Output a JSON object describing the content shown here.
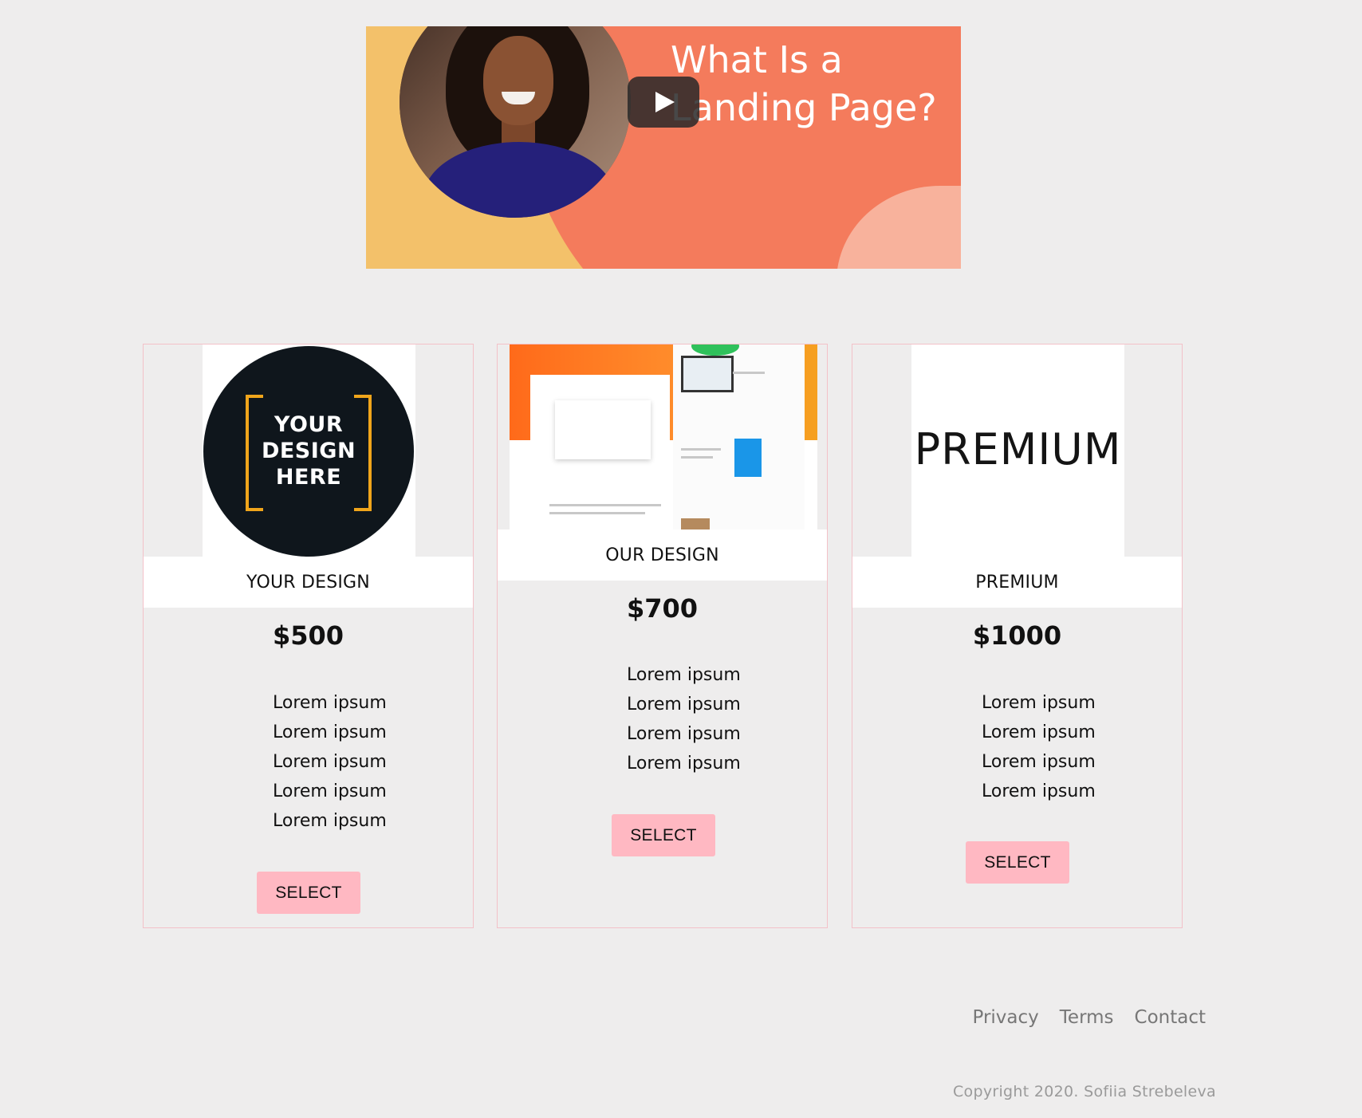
{
  "video": {
    "title_line1": "What Is a",
    "title_line2": "Landing Page?",
    "play_icon": "play-icon",
    "colors": {
      "yellow": "#f3c16a",
      "coral": "#f47b5c",
      "pink": "#f8b29c"
    }
  },
  "cards": [
    {
      "image_text": [
        "YOUR",
        "DESIGN",
        "HERE"
      ],
      "name": "YOUR DESIGN",
      "price": "$500",
      "features": [
        "Lorem ipsum",
        "Lorem ipsum",
        "Lorem ipsum",
        "Lorem ipsum",
        "Lorem ipsum"
      ],
      "button": "SELECT"
    },
    {
      "name": "OUR DESIGN",
      "price": "$700",
      "features": [
        "Lorem ipsum",
        "Lorem ipsum",
        "Lorem ipsum",
        "Lorem ipsum"
      ],
      "button": "SELECT"
    },
    {
      "image_text": "PREMIUM",
      "name": "PREMIUM",
      "price": "$1000",
      "features": [
        "Lorem ipsum",
        "Lorem ipsum",
        "Lorem ipsum",
        "Lorem ipsum"
      ],
      "button": "SELECT"
    }
  ],
  "footer": {
    "links": [
      "Privacy",
      "Terms",
      "Contact"
    ],
    "copyright": "Copyright 2020. Sofiia Strebeleva"
  },
  "colors": {
    "background": "#eeeded",
    "button": "#ffb8c2",
    "card_border": "#f3c1c8"
  }
}
